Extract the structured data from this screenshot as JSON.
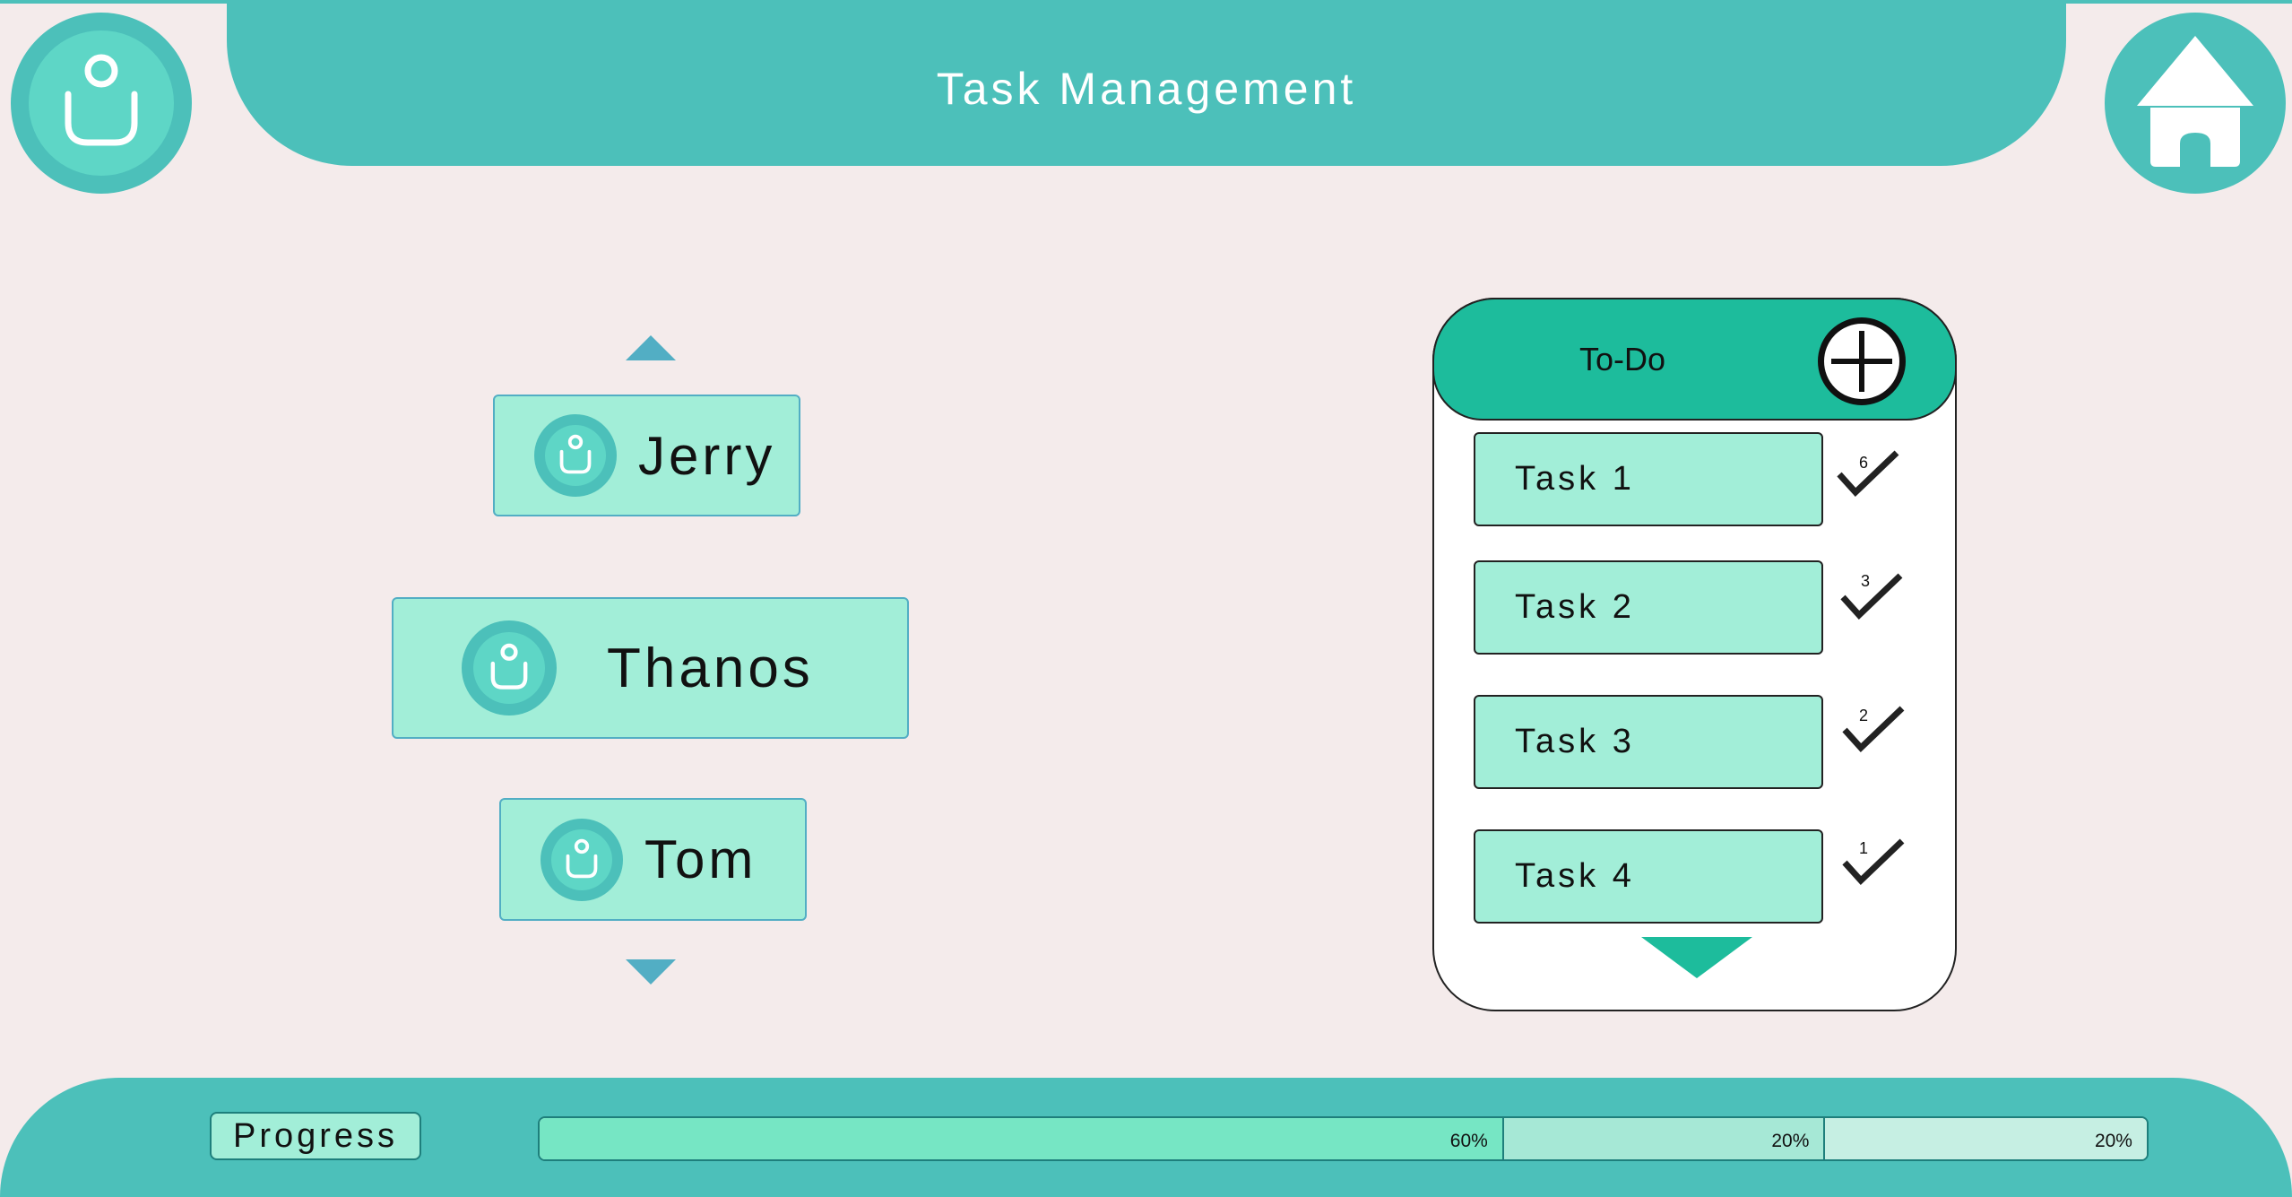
{
  "header": {
    "title": "Task Management"
  },
  "icons": {
    "profile": "profile-icon",
    "home": "home-icon",
    "add": "plus-icon",
    "check": "checkmark-icon"
  },
  "users": [
    {
      "name": "Jerry"
    },
    {
      "name": "Thanos"
    },
    {
      "name": "Tom"
    }
  ],
  "todo": {
    "title": "To-Do",
    "tasks": [
      {
        "label": "Task  1",
        "count": "6"
      },
      {
        "label": "Task  2",
        "count": "3"
      },
      {
        "label": "Task  3",
        "count": "2"
      },
      {
        "label": "Task  4",
        "count": "1"
      }
    ]
  },
  "progress": {
    "label": "Progress",
    "segments": [
      {
        "value": 60,
        "label": "60%",
        "color": "#76e6c4"
      },
      {
        "value": 20,
        "label": "20%",
        "color": "#a6e8d6"
      },
      {
        "value": 20,
        "label": "20%",
        "color": "#c6efe3"
      }
    ]
  },
  "colors": {
    "header": "#4cc0ba",
    "accent": "#1dbc9c",
    "card": "#a2eed8",
    "background": "#f4ebeb"
  }
}
